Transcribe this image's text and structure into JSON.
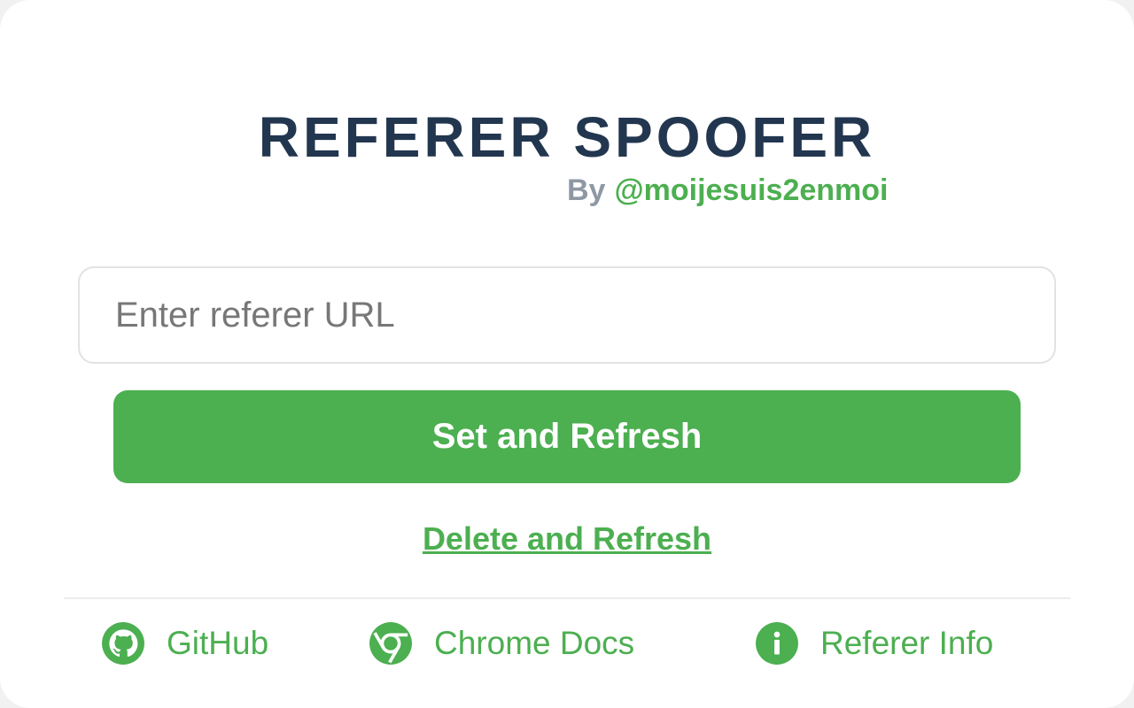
{
  "header": {
    "title": "REFERER SPOOFER",
    "by_prefix": "By",
    "author_handle": "@moijesuis2enmoi"
  },
  "form": {
    "url_placeholder": "Enter referer URL",
    "url_value": "",
    "set_button_label": "Set and Refresh",
    "delete_link_label": "Delete and Refresh"
  },
  "footer": {
    "links": [
      {
        "label": "GitHub",
        "icon": "github-icon"
      },
      {
        "label": "Chrome Docs",
        "icon": "chrome-icon"
      },
      {
        "label": "Referer Info",
        "icon": "info-icon"
      }
    ]
  },
  "colors": {
    "accent": "#4caf50",
    "title": "#22364f",
    "byline": "#8e98a4"
  }
}
